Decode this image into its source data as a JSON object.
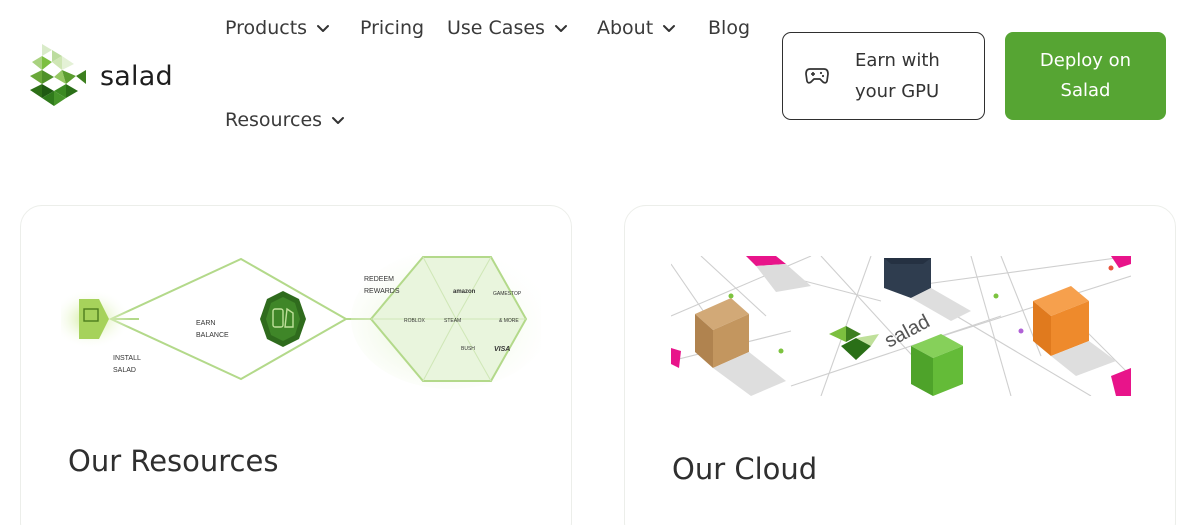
{
  "brand": {
    "name": "salad",
    "logo_icon": "salad-logo-icon"
  },
  "nav": {
    "products": "Products",
    "pricing": "Pricing",
    "use_cases": "Use Cases",
    "about": "About",
    "blog": "Blog",
    "resources": "Resources",
    "dropdown_icon": "chevron-down-icon"
  },
  "buttons": {
    "earn": {
      "line1": "Earn with",
      "line2": "your GPU",
      "icon": "gamepad-icon"
    },
    "deploy": {
      "line1": "Deploy on",
      "line2": "Salad"
    }
  },
  "cards": {
    "resources": {
      "title": "Our Resources",
      "illustration": {
        "install": [
          "INSTALL",
          "SALAD"
        ],
        "earn": [
          "EARN",
          "BALANCE"
        ],
        "redeem": [
          "REDEEM",
          "REWARDS"
        ],
        "rewards": [
          "amazon",
          "GAMESTOP",
          "ROBLOX",
          "STEAM",
          "& MORE",
          "BUSH",
          "VISA"
        ]
      }
    },
    "cloud": {
      "title": "Our Cloud",
      "illustration": {
        "label": "salad"
      }
    }
  },
  "colors": {
    "accent": "#56a533",
    "text": "#2e2e2e",
    "card_border": "#eceeea"
  }
}
